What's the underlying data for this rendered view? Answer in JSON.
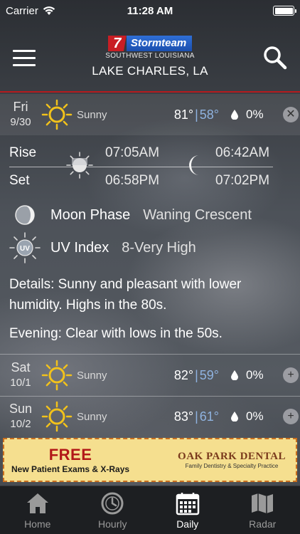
{
  "status_bar": {
    "carrier": "Carrier",
    "time": "11:28 AM"
  },
  "header": {
    "logo_mark": "7",
    "logo_word": "Stormteam",
    "logo_sub": "SOUTHWEST LOUISIANA",
    "location": "LAKE CHARLES, LA"
  },
  "days": [
    {
      "day": "Fri",
      "date": "9/30",
      "condition": "Sunny",
      "high": "81°",
      "low": "58°",
      "sep": "|",
      "pop": "0%",
      "action": "✕"
    },
    {
      "day": "Sat",
      "date": "10/1",
      "condition": "Sunny",
      "high": "82°",
      "low": "59°",
      "sep": "|",
      "pop": "0%",
      "action": "+"
    },
    {
      "day": "Sun",
      "date": "10/2",
      "condition": "Sunny",
      "high": "83°",
      "low": "61°",
      "sep": "|",
      "pop": "0%",
      "action": "+"
    }
  ],
  "detail": {
    "rise_label": "Rise",
    "set_label": "Set",
    "sunrise": "07:05AM",
    "sunset": "06:58PM",
    "moonrise": "06:42AM",
    "moonset": "07:02PM",
    "moon_phase_label": "Moon Phase",
    "moon_phase_value": "Waning Crescent",
    "uv_label": "UV Index",
    "uv_value": "8-Very High",
    "uv_badge": "UV",
    "details_text": "Details: Sunny and pleasant with lower humidity. Highs in the 80s.",
    "evening_text": "Evening: Clear with lows in the 50s."
  },
  "ad": {
    "headline": "FREE",
    "subline": "New Patient Exams & X-Rays",
    "brand": "OAK PARK DENTAL",
    "brand_sub": "Family Dentistry & Specialty Practice"
  },
  "tabs": [
    {
      "label": "Home",
      "icon": "home-icon"
    },
    {
      "label": "Hourly",
      "icon": "clock-icon"
    },
    {
      "label": "Daily",
      "icon": "calendar-icon",
      "active": true
    },
    {
      "label": "Radar",
      "icon": "map-icon"
    }
  ],
  "colors": {
    "accent_red": "#b51b1e",
    "low_temp": "#8fb3e0",
    "sun": "#f2c21b"
  }
}
